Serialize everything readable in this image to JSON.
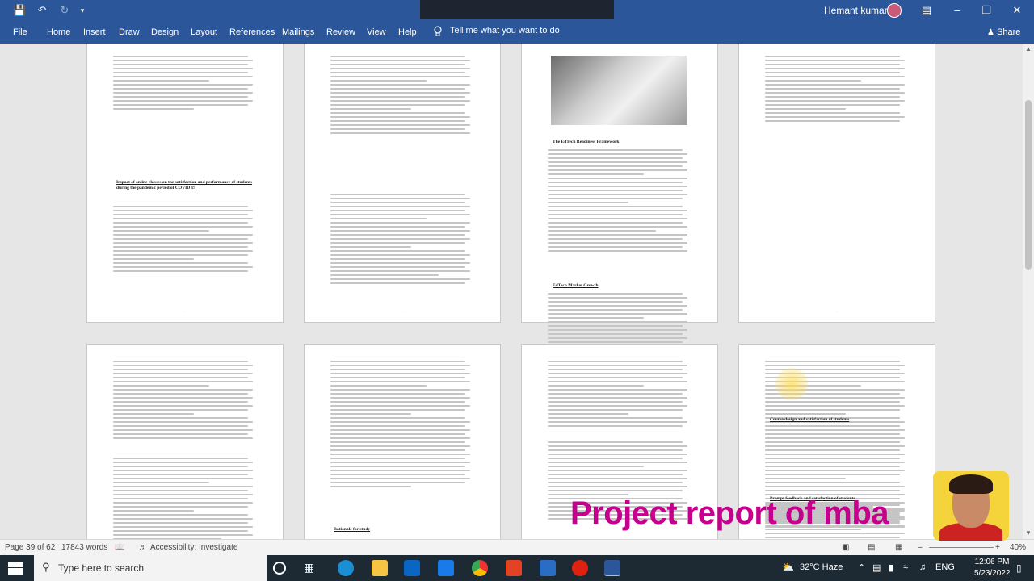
{
  "titlebar": {
    "user_name": "Hemant kumar",
    "window_controls": [
      "minimize-icon",
      "maximize-icon",
      "close-icon"
    ],
    "quick_access": [
      "save-icon",
      "undo-icon",
      "redo-icon",
      "customize-icon"
    ]
  },
  "ribbon": {
    "tabs": [
      "File",
      "Home",
      "Insert",
      "Draw",
      "Design",
      "Layout",
      "References",
      "Mailings",
      "Review",
      "View",
      "Help"
    ],
    "tell_me": "Tell me what you want to do",
    "share": "Share"
  },
  "pages": {
    "page1_heading": "Impact of online classes on the satisfaction and performance of students during the pandemic period of COVID 19",
    "page3_heading1": "The EdTech Readiness Framework",
    "page3_heading2": "EdTech Market Growth",
    "page6_heading": "Rationale for study",
    "page8_heading1": "Course design and satisfaction of students",
    "page8_heading2": "Prompt feedback and satisfaction of students"
  },
  "statusbar": {
    "page": "Page 39 of 62",
    "words": "17843 words",
    "accessibility": "Accessibility: Investigate",
    "zoom": "40%"
  },
  "taskbar": {
    "search_placeholder": "Type here to search",
    "weather": "32°C  Haze",
    "time": "12:06 PM",
    "date": "5/23/2022",
    "lang": "ENG"
  },
  "overlay": {
    "text": "Project report of mba"
  },
  "colors": {
    "word_blue": "#2b579a",
    "overlay_magenta": "#c4008c",
    "taskbar": "#1e2a33"
  }
}
